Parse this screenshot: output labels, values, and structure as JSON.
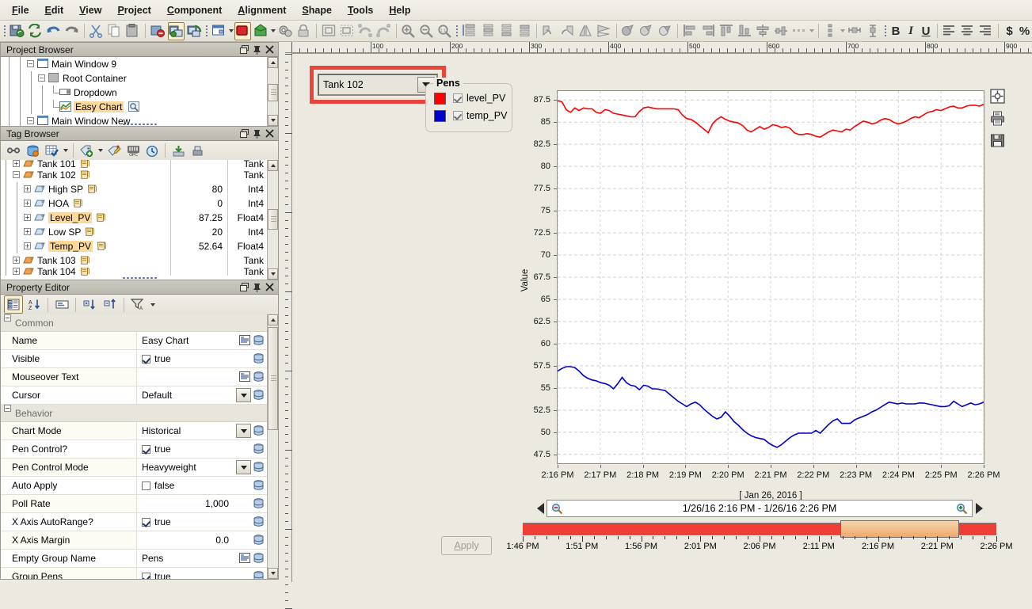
{
  "menu": {
    "items": [
      {
        "label": "File",
        "mnemonic": "F"
      },
      {
        "label": "Edit",
        "mnemonic": "E"
      },
      {
        "label": "View",
        "mnemonic": "V"
      },
      {
        "label": "Project",
        "mnemonic": "P"
      },
      {
        "label": "Component",
        "mnemonic": "C"
      },
      {
        "label": "Alignment",
        "mnemonic": "A"
      },
      {
        "label": "Shape",
        "mnemonic": "S"
      },
      {
        "label": "Tools",
        "mnemonic": "T"
      },
      {
        "label": "Help",
        "mnemonic": "H"
      }
    ]
  },
  "toolbar": {
    "bold_label": "B",
    "italic_label": "I",
    "underline_label": "U",
    "currency_label": "$",
    "percent_label": "%"
  },
  "project_browser": {
    "title": "Project Browser",
    "nodes": [
      {
        "label": "Main Window 9",
        "indent": 3,
        "expander": "minus",
        "icon": "window-icon",
        "highlight": false
      },
      {
        "label": "Root Container",
        "indent": 4,
        "expander": "minus",
        "icon": "container-icon",
        "highlight": false
      },
      {
        "label": "Dropdown",
        "indent": 5,
        "expander": "none",
        "icon": "dropdown-icon",
        "highlight": false
      },
      {
        "label": "Easy Chart",
        "indent": 5,
        "expander": "none",
        "icon": "chart-icon",
        "highlight": true
      },
      {
        "label": "Main Window New",
        "indent": 3,
        "expander": "minus",
        "icon": "window-icon",
        "highlight": false
      }
    ]
  },
  "tag_browser": {
    "title": "Tag Browser",
    "col_value_header": "",
    "rows": [
      {
        "name": "Tank 101",
        "value": "",
        "type": "Tank",
        "indent": 2,
        "expander": "plus",
        "highlight": false,
        "clipped": true
      },
      {
        "name": "Tank 102",
        "value": "",
        "type": "Tank",
        "indent": 2,
        "expander": "minus",
        "highlight": false
      },
      {
        "name": "High SP",
        "value": "80",
        "type": "Int4",
        "indent": 3,
        "expander": "plus",
        "highlight": false
      },
      {
        "name": "HOA",
        "value": "0",
        "type": "Int4",
        "indent": 3,
        "expander": "plus",
        "highlight": false
      },
      {
        "name": "Level_PV",
        "value": "87.25",
        "type": "Float4",
        "indent": 3,
        "expander": "plus",
        "highlight": true
      },
      {
        "name": "Low SP",
        "value": "20",
        "type": "Int4",
        "indent": 3,
        "expander": "plus",
        "highlight": false
      },
      {
        "name": "Temp_PV",
        "value": "52.64",
        "type": "Float4",
        "indent": 3,
        "expander": "plus",
        "highlight": true
      },
      {
        "name": "Tank 103",
        "value": "",
        "type": "Tank",
        "indent": 2,
        "expander": "plus",
        "highlight": false
      },
      {
        "name": "Tank 104",
        "value": "",
        "type": "Tank",
        "indent": 2,
        "expander": "plus",
        "highlight": false,
        "clipped": true
      }
    ]
  },
  "property_editor": {
    "title": "Property Editor",
    "categories": [
      {
        "name": "Common",
        "y": 0
      },
      {
        "name": "Behavior",
        "y": 1
      }
    ],
    "rows": [
      {
        "kind": "category",
        "label": "Common"
      },
      {
        "kind": "text",
        "label": "Name",
        "value": "Easy Chart",
        "editor": "text",
        "binding": true
      },
      {
        "kind": "bool",
        "label": "Visible",
        "value": "true",
        "checked": true,
        "binding": true
      },
      {
        "kind": "text",
        "label": "Mouseover Text",
        "value": "",
        "editor": "text",
        "binding": true
      },
      {
        "kind": "combo",
        "label": "Cursor",
        "value": "Default",
        "binding": true
      },
      {
        "kind": "category",
        "label": "Behavior"
      },
      {
        "kind": "combo",
        "label": "Chart Mode",
        "value": "Historical",
        "binding": true
      },
      {
        "kind": "bool",
        "label": "Pen Control?",
        "value": "true",
        "checked": true,
        "binding": true
      },
      {
        "kind": "combo",
        "label": "Pen Control Mode",
        "value": "Heavyweight",
        "binding": true
      },
      {
        "kind": "bool",
        "label": "Auto Apply",
        "value": "false",
        "checked": false,
        "binding": true
      },
      {
        "kind": "num",
        "label": "Poll Rate",
        "value": "1,000",
        "binding": true
      },
      {
        "kind": "bool",
        "label": "X Axis AutoRange?",
        "value": "true",
        "checked": true,
        "binding": true
      },
      {
        "kind": "num",
        "label": "X Axis Margin",
        "value": "0.0",
        "binding": true
      },
      {
        "kind": "text",
        "label": "Empty Group Name",
        "value": "Pens",
        "editor": "text",
        "binding": true
      },
      {
        "kind": "bool",
        "label": "Group Pens",
        "value": "true",
        "checked": true,
        "binding": true
      }
    ]
  },
  "canvas": {
    "ruler_labels": [
      "100",
      "200",
      "300",
      "400",
      "500",
      "600",
      "700",
      "800",
      "900"
    ],
    "dropdown": {
      "value": "Tank 102"
    },
    "pens": {
      "title": "Pens",
      "items": [
        {
          "label": "level_PV",
          "color": "#ff0000",
          "checked": true
        },
        {
          "label": "temp_PV",
          "color": "#0000cc",
          "checked": true
        }
      ]
    },
    "apply_button": {
      "label": "Apply",
      "enabled": false
    },
    "side_icons": [
      "expand-icon",
      "print-icon",
      "save-icon"
    ],
    "time_range": {
      "text": "1/26/16 2:16 PM - 1/26/16 2:26 PM",
      "zoom_out_icon": "zoom-out-icon",
      "zoom_in_icon": "zoom-in-icon",
      "prev_icon": "left-arrow-icon",
      "next_icon": "right-arrow-icon",
      "track_labels": [
        "1:46 PM",
        "1:51 PM",
        "1:56 PM",
        "2:01 PM",
        "2:06 PM",
        "2:11 PM",
        "2:16 PM",
        "2:21 PM",
        "2:26 PM"
      ],
      "selection_start": "2:16 PM",
      "selection_end": "2:26 PM"
    }
  },
  "chart_data": {
    "type": "line",
    "title": "",
    "xlabel": "[ Jan 26, 2016 ]",
    "ylabel": "Value",
    "ylim": [
      46.5,
      88.5
    ],
    "yticks": [
      47.5,
      50,
      52.5,
      55,
      57.5,
      60,
      62.5,
      65,
      67.5,
      70,
      72.5,
      75,
      77.5,
      80,
      82.5,
      85,
      87.5
    ],
    "xticks": [
      "2:16 PM",
      "2:17 PM",
      "2:18 PM",
      "2:19 PM",
      "2:20 PM",
      "2:21 PM",
      "2:22 PM",
      "2:23 PM",
      "2:24 PM",
      "2:25 PM",
      "2:26 PM"
    ],
    "xlim_labels": [
      "2:16 PM",
      "2:26 PM"
    ],
    "grid": true,
    "legend_position": "external-top-left",
    "series": [
      {
        "name": "level_PV",
        "color": "#ff0000",
        "values": [
          87.4,
          87.3,
          86.4,
          86.1,
          86.6,
          86.3,
          86.6,
          86.5,
          86.5,
          86.1,
          86.0,
          86.4,
          86.3,
          86.0,
          85.9,
          85.8,
          85.7,
          85.6,
          85.6,
          86.2,
          86.6,
          86.7,
          86.6,
          86.5,
          86.5,
          86.5,
          86.5,
          86.5,
          86.4,
          85.8,
          85.4,
          85.3,
          85.0,
          84.6,
          84.2,
          83.8,
          84.8,
          85.3,
          85.6,
          85.3,
          85.1,
          85.0,
          84.9,
          84.6,
          84.1,
          83.9,
          84.2,
          84.5,
          84.2,
          84.4,
          84.7,
          84.6,
          84.4,
          84.5,
          84.3,
          83.8,
          83.6,
          83.6,
          83.7,
          83.6,
          83.4,
          83.3,
          83.6,
          83.9,
          84.1,
          84.0,
          83.9,
          84.2,
          84.1,
          84.5,
          84.8,
          85.1,
          85.0,
          84.8,
          84.9,
          85.2,
          85.4,
          85.3,
          85.0,
          84.8,
          84.9,
          85.1,
          85.4,
          85.6,
          85.5,
          85.8,
          86.1,
          86.2,
          86.4,
          86.3,
          86.5,
          86.7,
          86.8,
          86.6,
          86.6,
          86.8,
          86.9,
          86.9,
          86.8,
          87.0
        ]
      },
      {
        "name": "temp_PV",
        "color": "#0000cc",
        "values": [
          56.9,
          57.2,
          57.4,
          57.4,
          57.3,
          56.9,
          56.4,
          56.1,
          55.9,
          55.8,
          55.6,
          55.5,
          55.3,
          54.9,
          55.5,
          56.2,
          55.6,
          55.3,
          55.2,
          54.8,
          55.3,
          55.2,
          54.9,
          54.9,
          54.8,
          54.7,
          54.3,
          53.9,
          53.5,
          53.2,
          52.9,
          53.2,
          53.4,
          53.1,
          52.6,
          52.2,
          51.8,
          51.5,
          51.7,
          52.3,
          51.8,
          51.2,
          50.8,
          50.3,
          49.9,
          49.6,
          49.4,
          49.3,
          49.2,
          48.8,
          48.5,
          48.3,
          48.6,
          49.0,
          49.4,
          49.7,
          49.9,
          49.9,
          49.9,
          49.9,
          50.2,
          49.9,
          50.4,
          50.9,
          51.3,
          51.5,
          51.0,
          51.0,
          51.0,
          51.4,
          51.6,
          51.8,
          52.0,
          52.3,
          52.5,
          52.8,
          53.1,
          53.4,
          53.3,
          53.2,
          53.3,
          53.2,
          53.2,
          53.2,
          53.3,
          53.3,
          53.2,
          53.1,
          53.0,
          52.9,
          52.9,
          53.0,
          53.5,
          53.2,
          52.9,
          53.1,
          53.3,
          53.1,
          53.2,
          53.4
        ]
      }
    ]
  }
}
